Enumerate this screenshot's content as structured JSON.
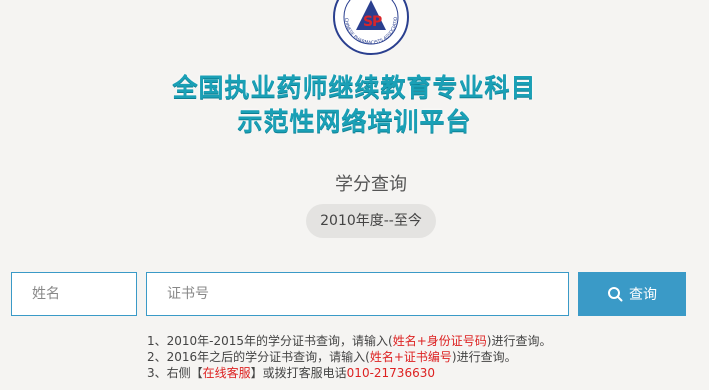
{
  "logo": {
    "name": "cpa-logo",
    "text": "CHINESE PHARMACISTS ASSOCIATION"
  },
  "headline": {
    "line1": "全国执业药师继续教育专业科目",
    "line2": "示范性网络培训平台"
  },
  "query": {
    "title": "学分查询",
    "period": "2010年度--至今"
  },
  "form": {
    "name_placeholder": "姓名",
    "cert_placeholder": "证书号",
    "submit_label": "查询",
    "submit_icon": "search-icon"
  },
  "notes": {
    "line1_prefix": "1、2010年-2015年的学分证书查询，请输入(",
    "line1_red": "姓名+身份证号码",
    "line1_suffix": ")进行查询。",
    "line2_prefix": "2、2016年之后的学分证书查询，请输入(",
    "line2_red": "姓名+证书编号",
    "line2_suffix": ")进行查询。",
    "line3_prefix": "3、右侧【",
    "line3_link": "在线客服",
    "line3_mid": "】或拨打客服电话",
    "line3_phone": "010-21736630"
  },
  "colors": {
    "accent": "#3a9ac7",
    "headline": "#1aa0b6",
    "highlight": "#dd2222",
    "background": "#f5f4f2"
  }
}
